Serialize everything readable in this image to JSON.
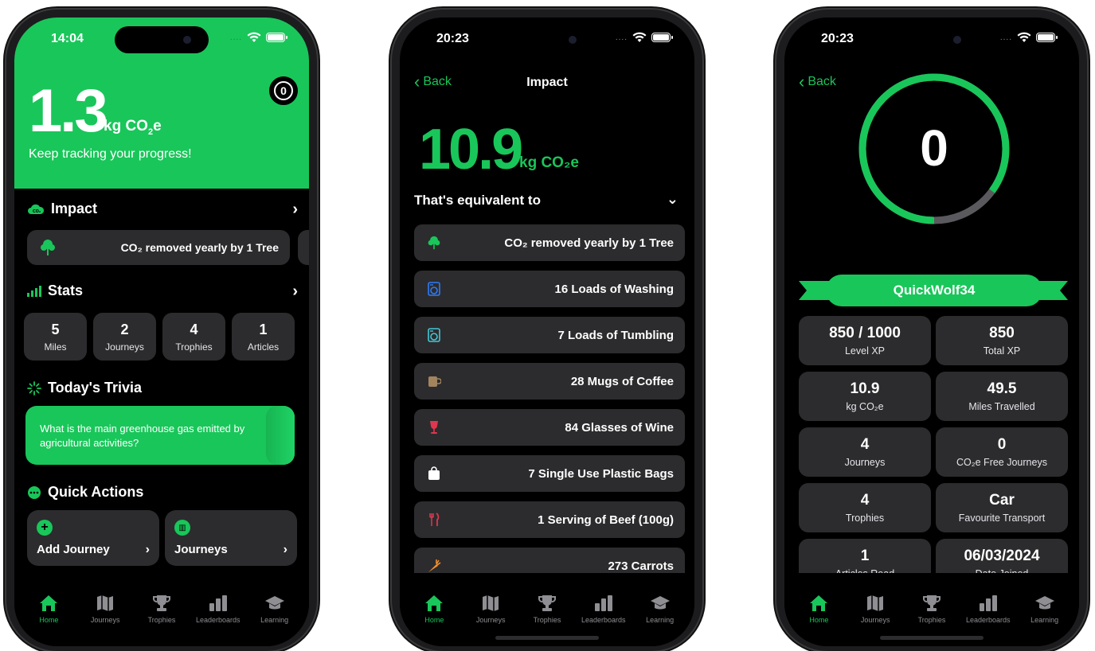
{
  "colors": {
    "accent": "#19c65a",
    "card": "#2c2c2e",
    "background": "#000000"
  },
  "tabs": [
    "Home",
    "Journeys",
    "Trophies",
    "Leaderboards",
    "Learning"
  ],
  "phone1": {
    "time": "14:04",
    "hero_value": "1.3",
    "hero_unit": "kg CO",
    "hero_unit_sub": "2",
    "hero_unit_end": "e",
    "hero_subtitle": "Keep tracking your progress!",
    "badge": "0",
    "impact_title": "Impact",
    "impact_card": "CO₂ removed yearly by 1 Tree",
    "stats_title": "Stats",
    "stats": [
      {
        "value": "5",
        "label": "Miles"
      },
      {
        "value": "2",
        "label": "Journeys"
      },
      {
        "value": "4",
        "label": "Trophies"
      },
      {
        "value": "1",
        "label": "Articles"
      }
    ],
    "trivia_title": "Today's Trivia",
    "trivia_question": "What is the main greenhouse gas emitted by agricultural activities?",
    "quick_actions_title": "Quick Actions",
    "quick_actions": [
      {
        "label": "Add Journey"
      },
      {
        "label": "Journeys"
      }
    ]
  },
  "phone2": {
    "time": "20:23",
    "back": "Back",
    "title": "Impact",
    "value": "10.9",
    "unit": "kg CO₂e",
    "equivalent": "That's equivalent to",
    "items": [
      {
        "label": "CO₂ removed yearly by 1 Tree",
        "icon": "tree-icon"
      },
      {
        "label": "16 Loads of Washing",
        "icon": "washing-machine-icon"
      },
      {
        "label": "7 Loads of Tumbling",
        "icon": "tumble-dryer-icon"
      },
      {
        "label": "28 Mugs of Coffee",
        "icon": "coffee-mug-icon"
      },
      {
        "label": "84 Glasses of Wine",
        "icon": "wine-glass-icon"
      },
      {
        "label": "7 Single Use Plastic Bags",
        "icon": "bag-icon"
      },
      {
        "label": "1 Serving of Beef (100g)",
        "icon": "fork-knife-icon"
      },
      {
        "label": "273 Carrots",
        "icon": "carrot-icon"
      }
    ]
  },
  "phone3": {
    "time": "20:23",
    "back": "Back",
    "level": "0",
    "level_progress": 0.85,
    "username": "QuickWolf34",
    "grid": [
      {
        "value": "850 / 1000",
        "label": "Level XP"
      },
      {
        "value": "850",
        "label": "Total XP"
      },
      {
        "value": "10.9",
        "label": "kg CO₂e"
      },
      {
        "value": "49.5",
        "label": "Miles Travelled"
      },
      {
        "value": "4",
        "label": "Journeys"
      },
      {
        "value": "0",
        "label": "CO₂e Free Journeys"
      },
      {
        "value": "4",
        "label": "Trophies"
      },
      {
        "value": "Car",
        "label": "Favourite Transport"
      },
      {
        "value": "1",
        "label": "Articles Read"
      },
      {
        "value": "06/03/2024",
        "label": "Date Joined"
      }
    ]
  }
}
